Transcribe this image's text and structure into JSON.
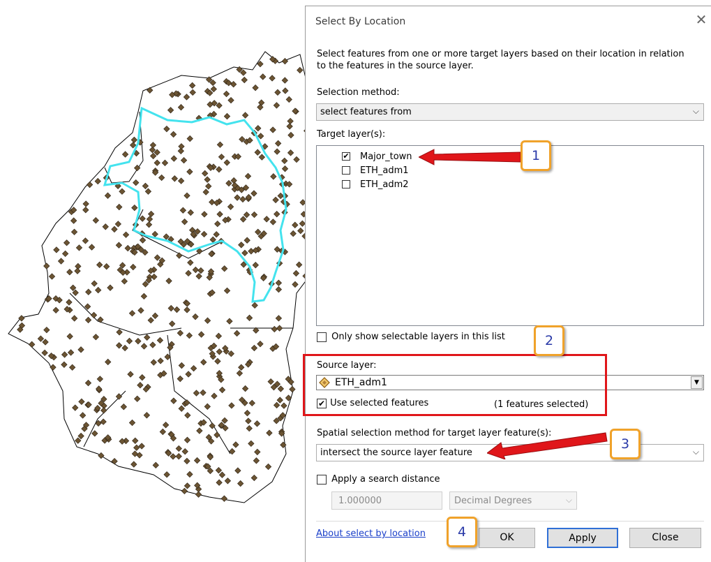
{
  "dialog": {
    "title": "Select By Location",
    "description": "Select features from one or more target layers based on their location in relation to the features in the source layer.",
    "selection_method_label": "Selection method:",
    "selection_method_value": "select features from",
    "target_layers_label": "Target layer(s):",
    "target_layers": [
      {
        "name": "Major_town",
        "checked": true
      },
      {
        "name": "ETH_adm1",
        "checked": false
      },
      {
        "name": "ETH_adm2",
        "checked": false
      }
    ],
    "only_selectable_label": "Only show selectable layers in this list",
    "source_layer_label": "Source layer:",
    "source_layer_value": "ETH_adm1",
    "use_selected_label": "Use selected features",
    "features_selected": "(1 features selected)",
    "spatial_method_label": "Spatial selection method for target layer feature(s):",
    "spatial_method_value": "intersect the source layer feature",
    "search_distance_label": "Apply a search distance",
    "search_distance_value": "1.000000",
    "units_value": "Decimal Degrees",
    "about_link": "About select by location",
    "ok_label": "OK",
    "apply_label": "Apply",
    "close_label": "Close"
  },
  "callouts": [
    "1",
    "2",
    "3",
    "4"
  ],
  "colors": {
    "callout_border": "#f0a22a",
    "callout_text": "#2a3aa8",
    "arrow": "#e0161a",
    "highlight_outline": "#44e3ee",
    "point_fill": "#6b5433"
  }
}
